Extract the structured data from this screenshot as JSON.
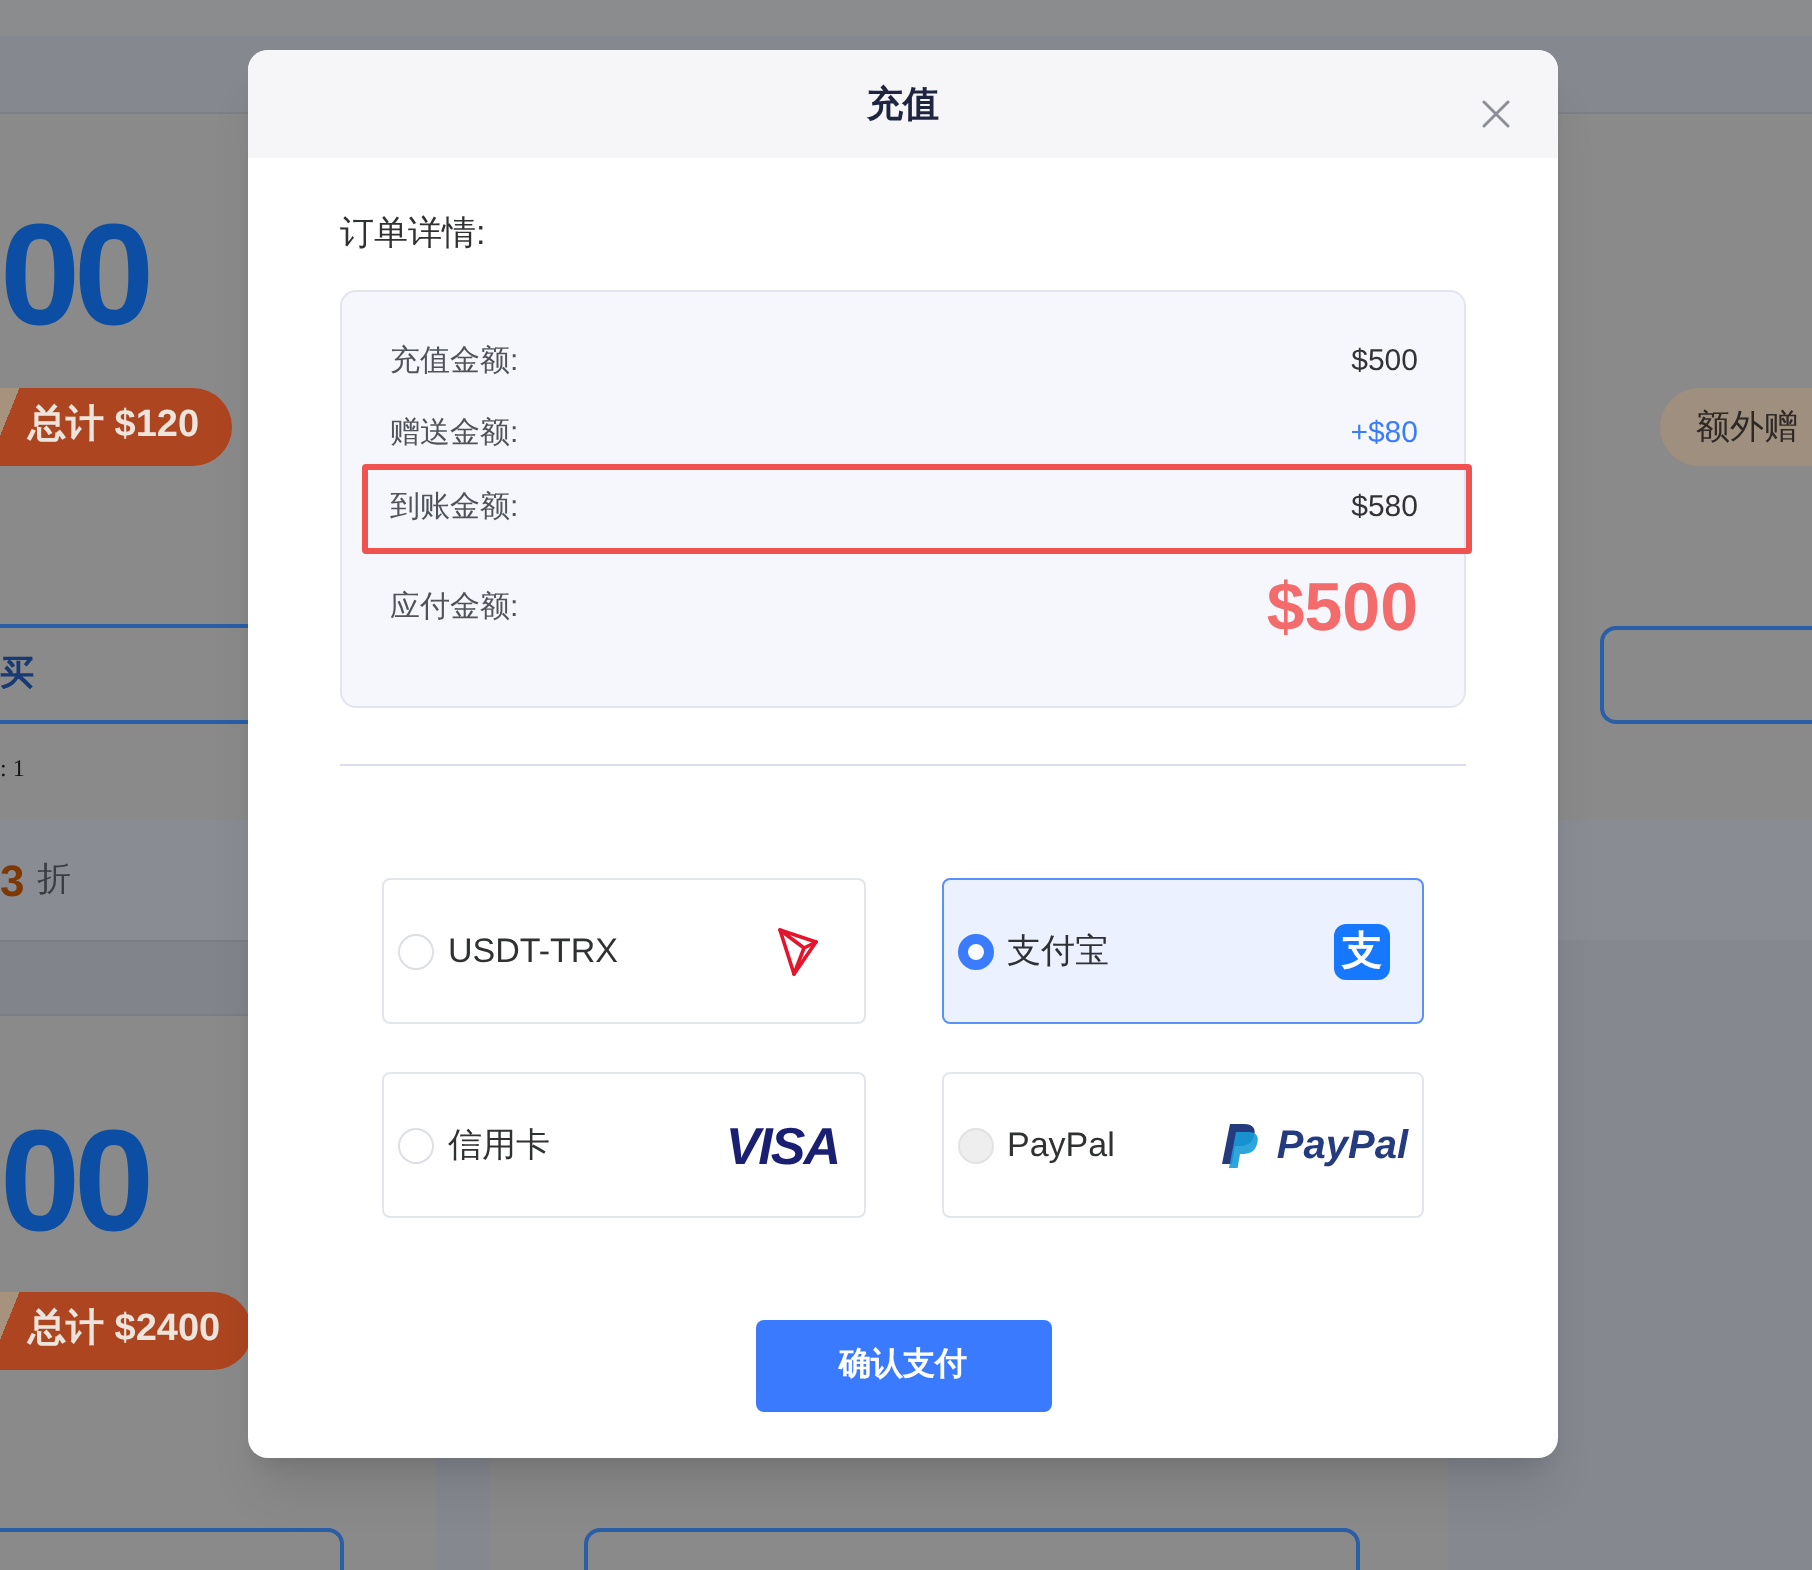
{
  "background": {
    "left_cards": [
      {
        "price": "00",
        "total_tag": "总计 $120",
        "buy_button": "买",
        "stock_note": ": 1",
        "discount_value": "3",
        "discount_unit": "折"
      },
      {
        "price": "00",
        "total_tag": "总计 $2400"
      }
    ],
    "right_cards": [
      {
        "bonus_tag": "额外赠"
      }
    ]
  },
  "dialog": {
    "title": "充值",
    "section_title": "订单详情:",
    "details": [
      {
        "label": "充值金额:",
        "value": "$500",
        "kind": "plain",
        "highlighted": false
      },
      {
        "label": "赠送金额:",
        "value": "+$80",
        "kind": "bonus",
        "highlighted": false
      },
      {
        "label": "到账金额:",
        "value": "$580",
        "kind": "plain",
        "highlighted": true
      },
      {
        "label": "应付金额:",
        "value": "$500",
        "kind": "total",
        "highlighted": false
      }
    ],
    "payment_methods": [
      {
        "label": "USDT-TRX",
        "kind": "tron",
        "selected": false,
        "disabled": false
      },
      {
        "label": "支付宝",
        "kind": "alipay",
        "logo_text": "支",
        "selected": true,
        "disabled": false
      },
      {
        "label": "信用卡",
        "kind": "visa",
        "logo_text": "VISA",
        "selected": false,
        "disabled": false
      },
      {
        "label": "PayPal",
        "kind": "paypal",
        "logo_text": "PayPal",
        "selected": false,
        "disabled": true
      }
    ],
    "confirm_button": "确认支付"
  }
}
